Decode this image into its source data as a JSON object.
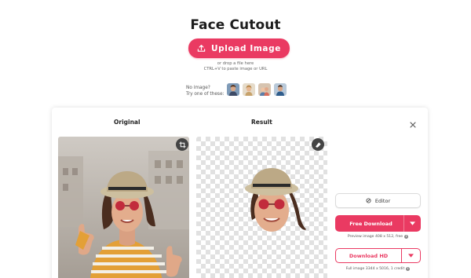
{
  "header": {
    "title": "Face Cutout",
    "upload_label": "Upload Image",
    "hint_drop": "or drop a file here",
    "hint_paste": "CTRL+V to paste image or URL"
  },
  "samples": {
    "label_line1": "No image?",
    "label_line2": "Try one of these:",
    "thumbs": [
      "sample-1",
      "sample-2",
      "sample-3",
      "sample-4"
    ]
  },
  "result_modal": {
    "original_label": "Original",
    "result_label": "Result",
    "editor_label": "Editor",
    "free_download_label": "Free Download",
    "preview_note": "Preview image 408 x 512, free",
    "download_hd_label": "Download HD",
    "full_note": "Full image 3344 x 5016, 1 credit",
    "info_glyph": "i"
  },
  "colors": {
    "accent": "#ea3a62",
    "text": "#1c1c1c"
  },
  "icons": {
    "upload": "upload-icon",
    "close": "close-icon",
    "crop": "crop-icon",
    "eraser": "eraser-icon",
    "editor": "editor-icon",
    "caret": "chevron-down-icon"
  }
}
